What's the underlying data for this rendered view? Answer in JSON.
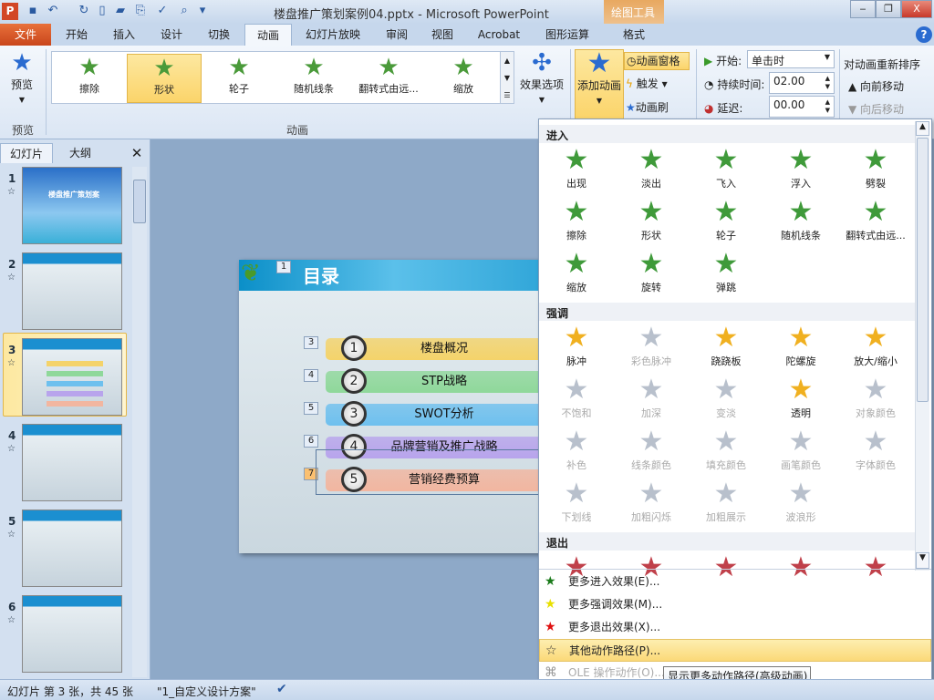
{
  "window": {
    "title": "楼盘推广策划案例04.pptx - Microsoft PowerPoint",
    "context_tab": "绘图工具",
    "controls": [
      "‒",
      "❐",
      "X"
    ]
  },
  "tabs": [
    "文件",
    "开始",
    "插入",
    "设计",
    "切换",
    "动画",
    "幻灯片放映",
    "审阅",
    "视图",
    "Acrobat",
    "图形运算",
    "格式"
  ],
  "active_tab": "动画",
  "ribbon": {
    "preview": {
      "label": "预览",
      "group": "预览"
    },
    "gallery": [
      {
        "label": "擦除"
      },
      {
        "label": "形状",
        "selected": true
      },
      {
        "label": "轮子"
      },
      {
        "label": "随机线条"
      },
      {
        "label": "翻转式由远..."
      },
      {
        "label": "缩放"
      }
    ],
    "animation_group": "动画",
    "effect_options": "效果选项",
    "add_animation": "添加动画",
    "animation_pane": "动画窗格",
    "trigger": "触发",
    "painter": "动画刷",
    "start_label": "开始:",
    "start_value": "单击时",
    "duration_label": "持续时间:",
    "duration_value": "02.00",
    "delay_label": "延迟:",
    "delay_value": "00.00",
    "reorder_title": "对动画重新排序",
    "move_earlier": "向前移动",
    "move_later": "向后移动"
  },
  "left_pane": {
    "tabs": [
      "幻灯片",
      "大纲"
    ],
    "slides": [
      "1",
      "2",
      "3",
      "4",
      "5",
      "6"
    ],
    "current": "3",
    "slide1_title": "楼盘推广策划案"
  },
  "slide": {
    "title": "目录",
    "title_tag": "1",
    "items": [
      {
        "num": "1",
        "text": "楼盘概况",
        "tag": "3",
        "color": "#f4d36a"
      },
      {
        "num": "2",
        "text": "STP战略",
        "tag": "4",
        "color": "#8fd89a"
      },
      {
        "num": "3",
        "text": "SWOT分析",
        "tag": "5",
        "color": "#6ec0ee"
      },
      {
        "num": "4",
        "text": "品牌营销及推广战略",
        "tag": "6",
        "color": "#b8a4ec"
      },
      {
        "num": "5",
        "text": "营销经费预算",
        "tag": "7",
        "color": "#f2b6a0"
      }
    ]
  },
  "menu": {
    "sections": [
      {
        "title": "进入",
        "color": "#3f9a3a",
        "items": [
          {
            "label": "出现"
          },
          {
            "label": "淡出"
          },
          {
            "label": "飞入"
          },
          {
            "label": "浮入"
          },
          {
            "label": "劈裂"
          },
          {
            "label": "擦除"
          },
          {
            "label": "形状"
          },
          {
            "label": "轮子"
          },
          {
            "label": "随机线条"
          },
          {
            "label": "翻转式由远..."
          },
          {
            "label": "缩放"
          },
          {
            "label": "旋转"
          },
          {
            "label": "弹跳"
          }
        ]
      },
      {
        "title": "强调",
        "color": "#f0b020",
        "items": [
          {
            "label": "脉冲"
          },
          {
            "label": "彩色脉冲",
            "disabled": true
          },
          {
            "label": "跷跷板"
          },
          {
            "label": "陀螺旋"
          },
          {
            "label": "放大/缩小"
          },
          {
            "label": "不饱和",
            "disabled": true
          },
          {
            "label": "加深",
            "disabled": true
          },
          {
            "label": "变淡",
            "disabled": true
          },
          {
            "label": "透明"
          },
          {
            "label": "对象颜色",
            "disabled": true
          },
          {
            "label": "补色",
            "disabled": true
          },
          {
            "label": "线条颜色",
            "disabled": true
          },
          {
            "label": "填充颜色",
            "disabled": true
          },
          {
            "label": "画笔颜色",
            "disabled": true
          },
          {
            "label": "字体颜色",
            "disabled": true
          },
          {
            "label": "下划线",
            "disabled": true
          },
          {
            "label": "加粗闪烁",
            "disabled": true
          },
          {
            "label": "加粗展示",
            "disabled": true
          },
          {
            "label": "波浪形",
            "disabled": true
          }
        ]
      },
      {
        "title": "退出",
        "color": "#c0404a",
        "items": []
      }
    ],
    "commands": [
      {
        "label": "更多进入效果(E)...",
        "icon": "green-star-icon",
        "color": "#1a7a1a"
      },
      {
        "label": "更多强调效果(M)...",
        "icon": "yellow-star-icon",
        "color": "#e8e000"
      },
      {
        "label": "更多退出效果(X)...",
        "icon": "red-star-icon",
        "color": "#e01010"
      },
      {
        "label": "其他动作路径(P)...",
        "icon": "path-star-icon",
        "color": "#ffffff",
        "highlighted": true
      },
      {
        "label": "OLE 操作动作(O)...",
        "icon": "ole-icon",
        "color": "#999999",
        "disabled": true
      }
    ],
    "tooltip": "显示更多动作路径(高级动画)"
  },
  "status": {
    "slide_info": "幻灯片 第 3 张，共 45 张",
    "theme": "\"1_自定义设计方案\""
  }
}
